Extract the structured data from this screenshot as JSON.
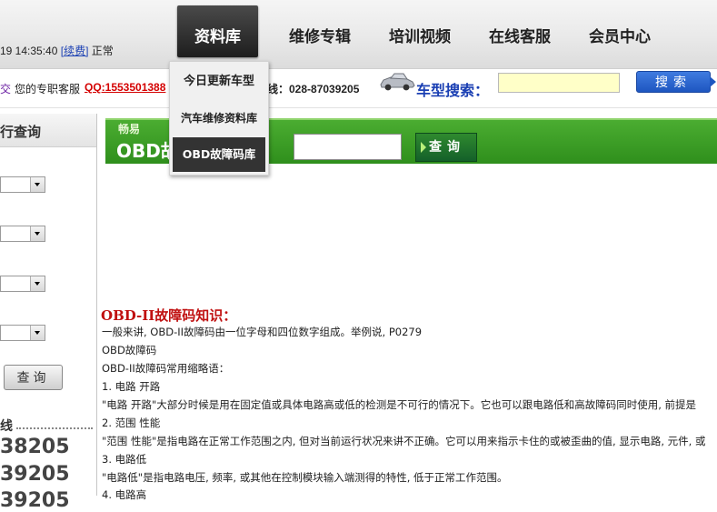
{
  "header": {
    "datetime": "19 14:35:40",
    "renew_link": "[续费]",
    "status": "正常",
    "nav": [
      {
        "label": "资料库"
      },
      {
        "label": "维修专辑"
      },
      {
        "label": "培训视频"
      },
      {
        "label": "在线客服"
      },
      {
        "label": "会员中心"
      }
    ]
  },
  "dropdown": {
    "items": [
      {
        "label": "今日更新车型"
      },
      {
        "label": "汽车维修资料库"
      },
      {
        "label": "OBD故障码库"
      }
    ]
  },
  "bar2": {
    "fragment": "交",
    "service_label": "您的专职客服",
    "qq": "QQ:1553501388",
    "tel": "线：028-87039205",
    "car_search_label": "车型搜索：",
    "search_input_value": "",
    "search_button": "搜索"
  },
  "left_panel": {
    "title": "行查询",
    "query_button": "查询",
    "hotline_label": "线",
    "phones": [
      "38205",
      "39205",
      "39205"
    ]
  },
  "banner": {
    "small_text": "畅易",
    "title": "OBD故",
    "input_value": "",
    "button": "查询"
  },
  "content": {
    "title": "OBD-II故障码知识：",
    "lines": [
      "一般来讲, OBD-II故障码由一位字母和四位数字组成。举例说, P0279",
      "OBD故障码",
      "OBD-II故障码常用缩略语：",
      "1. 电路 开路",
      "\"电路 开路\"大部分时候是用在固定值或具体电路高或低的检测是不可行的情况下。它也可以跟电路低和高故障码同时使用, 前提是",
      "2. 范围 性能",
      "\"范围 性能\"是指电路在正常工作范围之内, 但对当前运行状况来讲不正确。它可以用来指示卡住的或被歪曲的值, 显示电路, 元件, 或",
      "3. 电路低",
      "\"电路低\"是指电路电压, 频率, 或其他在控制模块输入端测得的特性, 低于正常工作范围。",
      "4. 电路高"
    ]
  }
}
